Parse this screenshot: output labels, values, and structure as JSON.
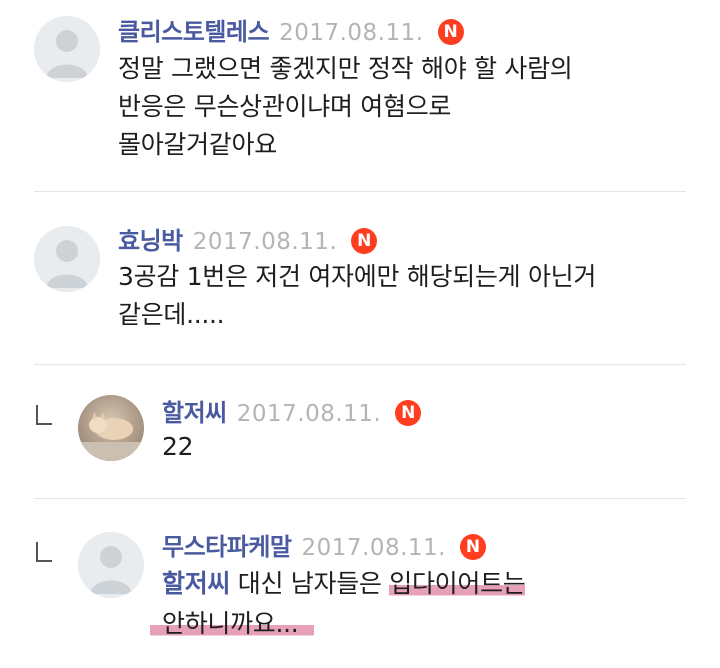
{
  "comments": [
    {
      "author": "클리스토텔레스",
      "date": "2017.08.11.",
      "badge": "N",
      "avatar": "default-avatar-icon",
      "lines": [
        "정말 그랬으면 좋겠지만 정작 해야 할 사람의",
        "반응은 무슨상관이냐며 여혐으로",
        "몰아갈거같아요"
      ]
    },
    {
      "author": "효닝박",
      "date": "2017.08.11.",
      "badge": "N",
      "avatar": "default-avatar-icon",
      "lines": [
        "3공감 1번은 저건 여자에만 해당되는게 아닌거",
        "같은데....."
      ]
    }
  ],
  "replies": [
    {
      "author": "할저씨",
      "date": "2017.08.11.",
      "badge": "N",
      "avatar": "cat-photo-avatar",
      "text": "22"
    },
    {
      "author": "무스타파케말",
      "date": "2017.08.11.",
      "badge": "N",
      "avatar": "default-avatar-icon",
      "mention": "할저씨",
      "line1_plain": " 대신 남자들은 ",
      "line1_highlight": "입다이어트는",
      "line2_highlight": "안하니까요..."
    }
  ],
  "colors": {
    "author": "#4a5aa0",
    "date": "#b4b4b4",
    "badge": "#ff3d1f",
    "highlight": "#e6a0b8",
    "text": "#1e1e1e"
  }
}
